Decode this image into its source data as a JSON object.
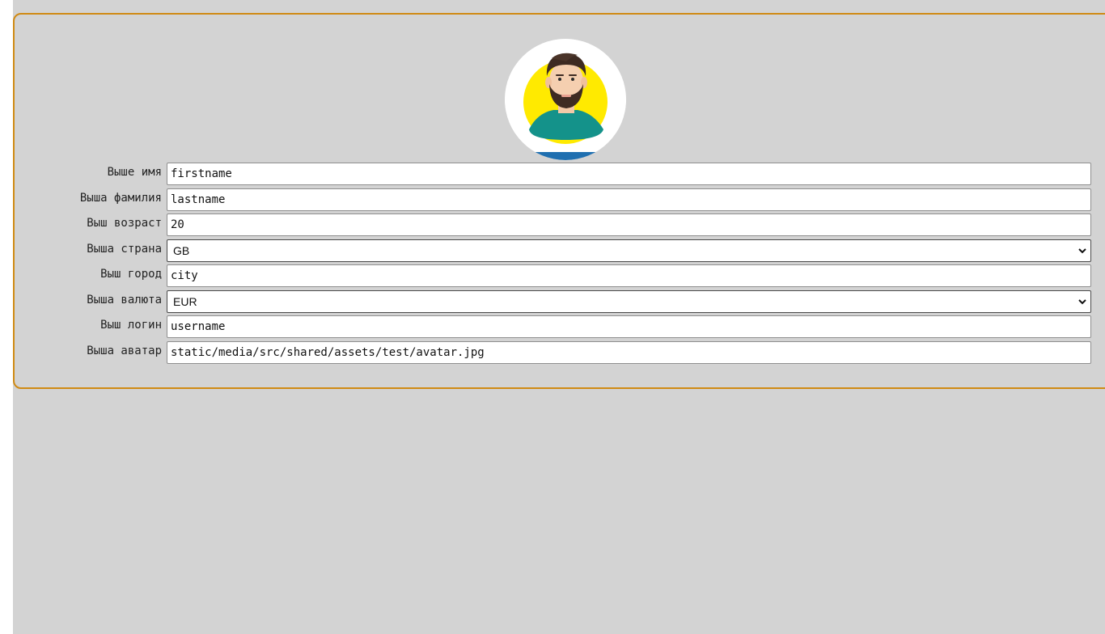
{
  "profile": {
    "avatar_alt": "avatar",
    "fields": [
      {
        "label": "Выше имя",
        "value": "firstname",
        "type": "input"
      },
      {
        "label": "Выша фамилия",
        "value": "lastname",
        "type": "input"
      },
      {
        "label": "Выш возраст",
        "value": "20",
        "type": "input"
      },
      {
        "label": "Выша страна",
        "value": "GB",
        "type": "select"
      },
      {
        "label": "Выш город",
        "value": "city",
        "type": "input"
      },
      {
        "label": "Выша валюта",
        "value": "EUR",
        "type": "select"
      },
      {
        "label": "Выш логин",
        "value": "username",
        "type": "input"
      },
      {
        "label": "Выша аватар",
        "value": "static/media/src/shared/assets/test/avatar.jpg",
        "type": "input"
      }
    ]
  },
  "colors": {
    "page_bg": "#d3d3d3",
    "card_border": "#d08a14",
    "avatar_yellow": "#ffea00",
    "avatar_shirt": "#14928a",
    "avatar_stripe": "#1f6fb0"
  }
}
